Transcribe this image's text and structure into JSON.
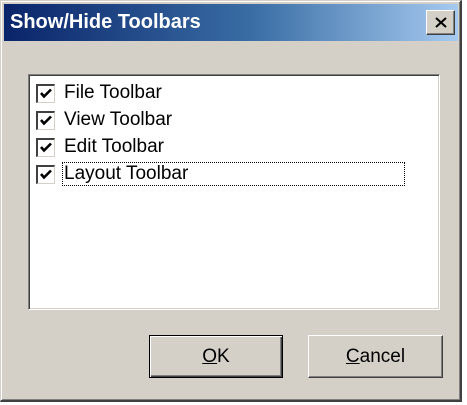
{
  "window": {
    "title": "Show/Hide Toolbars"
  },
  "toolbars": {
    "items": [
      {
        "label": "File Toolbar",
        "checked": true
      },
      {
        "label": "View Toolbar",
        "checked": true
      },
      {
        "label": "Edit Toolbar",
        "checked": true
      },
      {
        "label": "Layout Toolbar",
        "checked": true,
        "focused": true
      }
    ]
  },
  "buttons": {
    "ok": {
      "mnemonic": "O",
      "rest": "K"
    },
    "cancel": {
      "mnemonic": "C",
      "rest": "ancel"
    }
  },
  "icons": {
    "close": "close-icon",
    "check": "check-icon"
  },
  "colors": {
    "title_bar_start": "#0a246a",
    "title_bar_end": "#a6caf0",
    "dialog_face": "#d4d0c8"
  }
}
